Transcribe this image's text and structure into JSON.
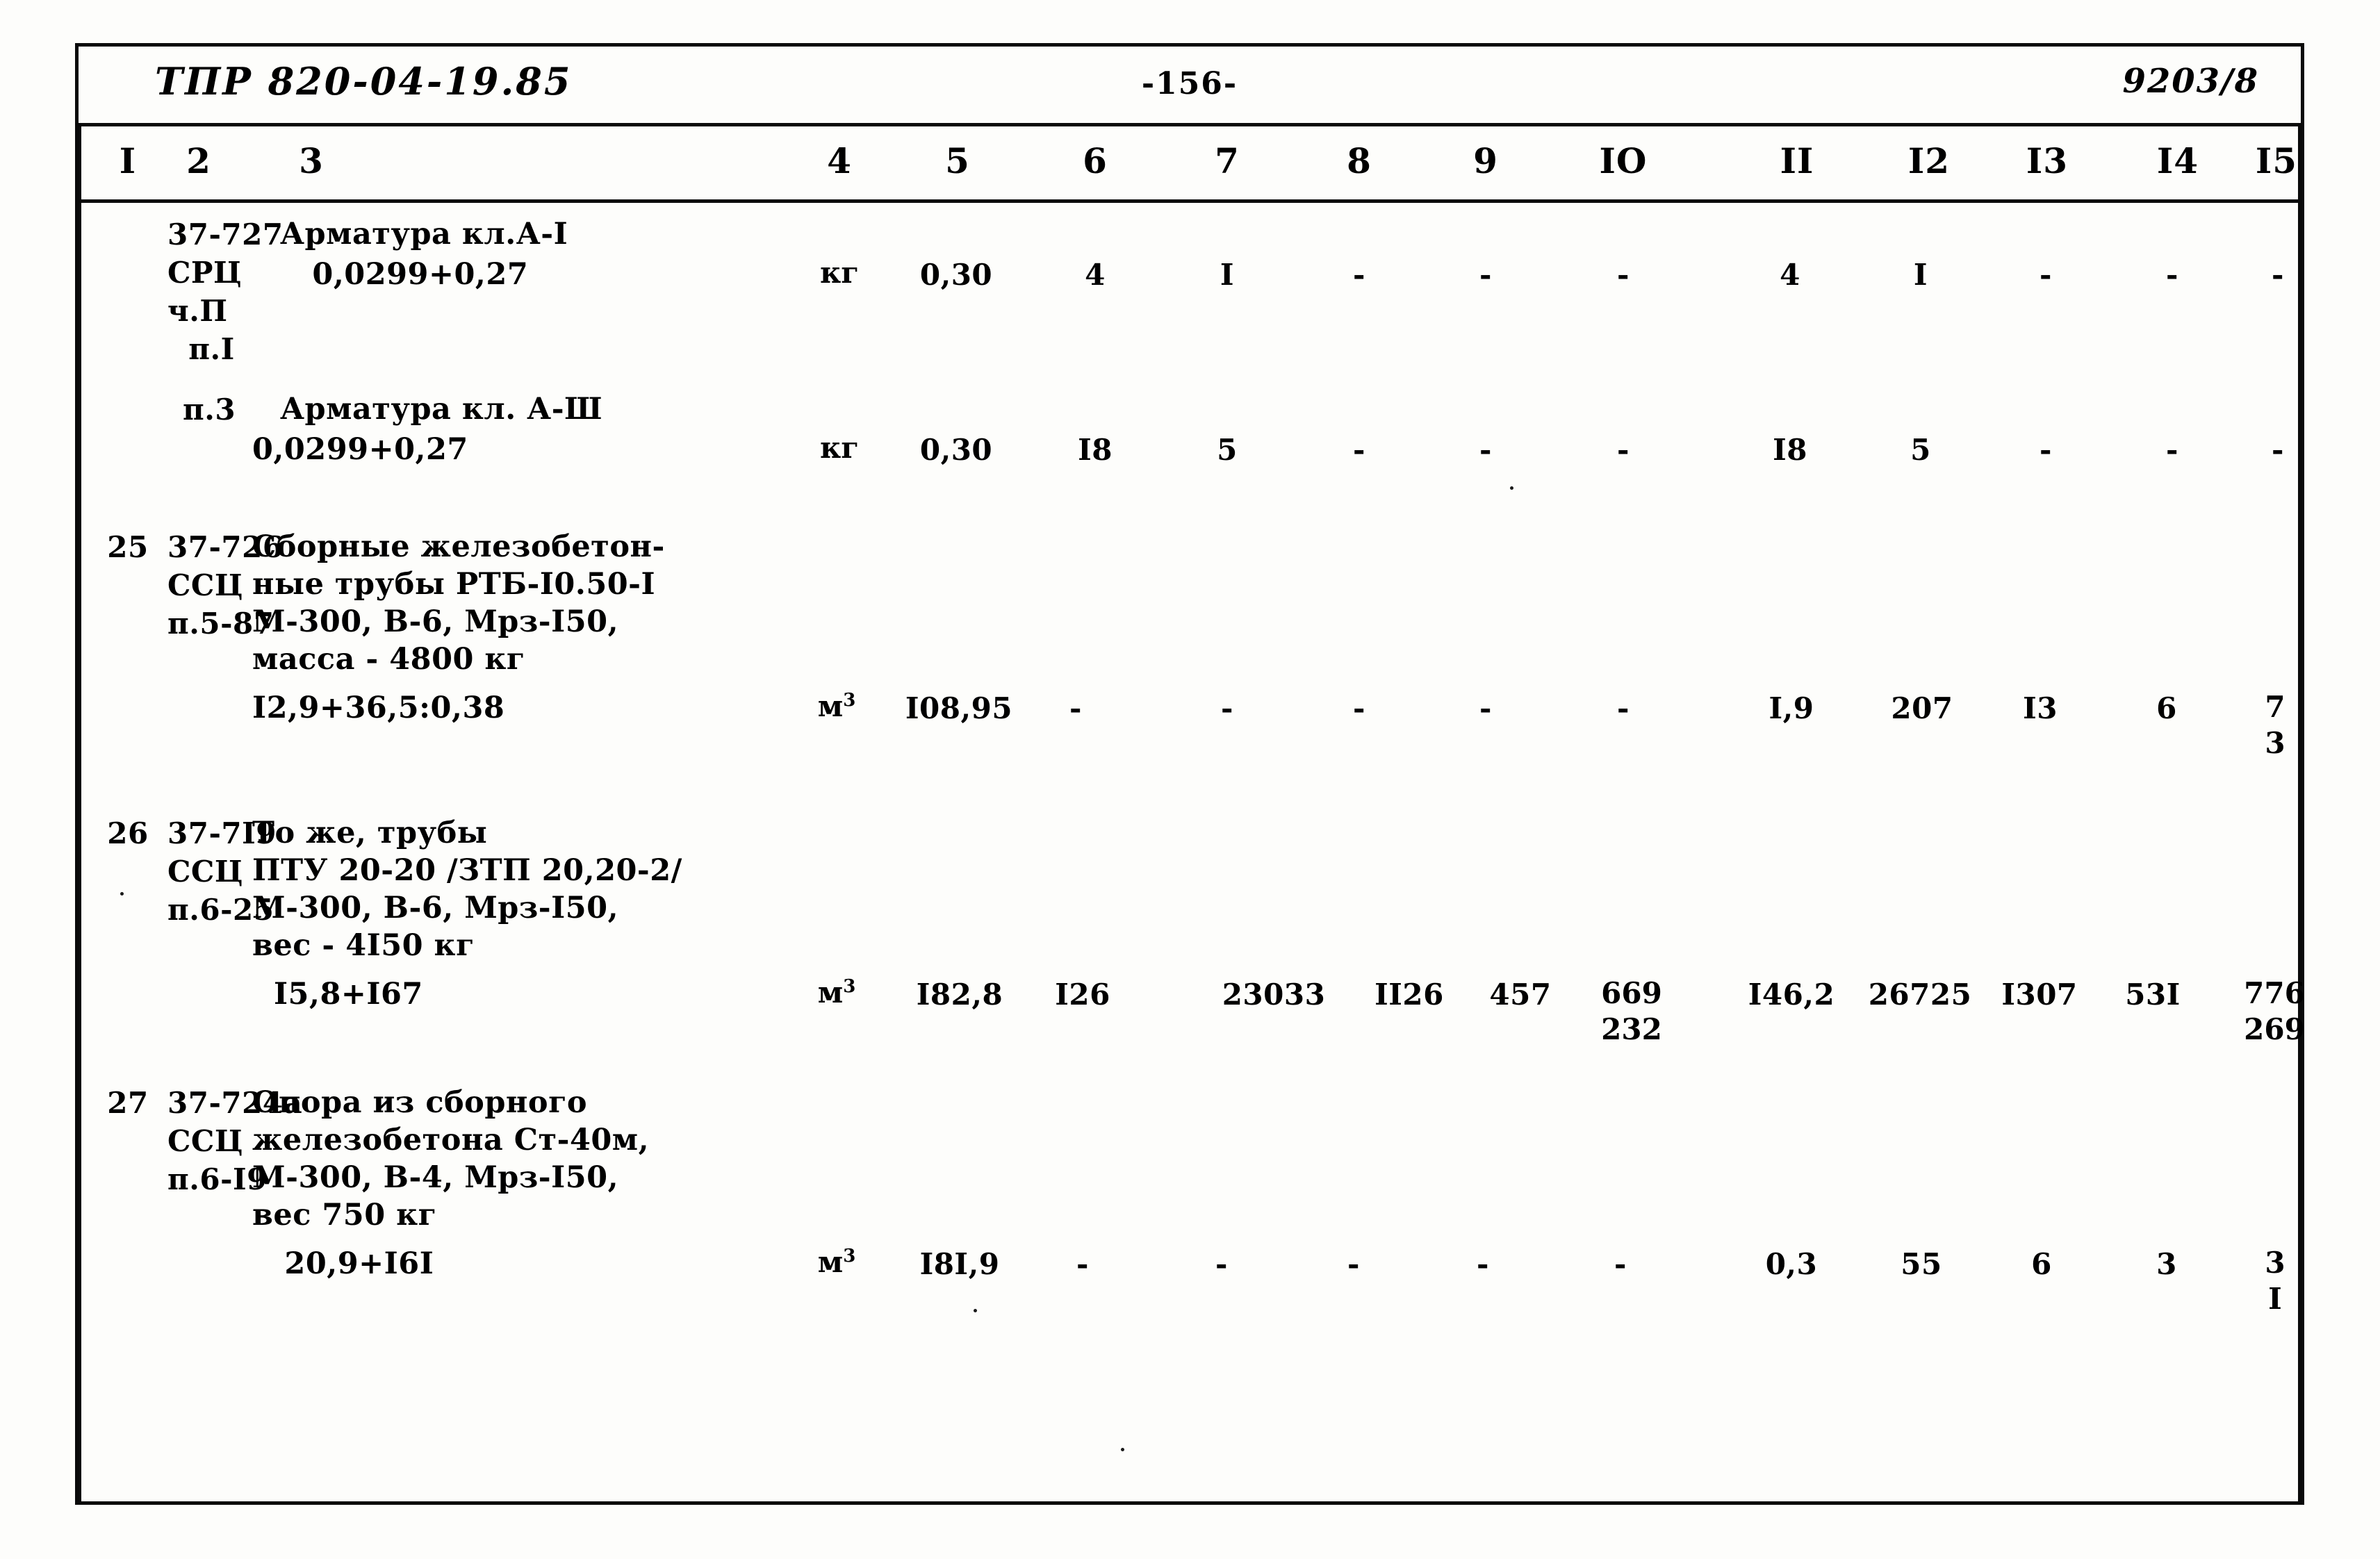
{
  "document": {
    "header": {
      "left_code": "ТПР 820-04-19.85",
      "page_number": "-156-",
      "right_code": "9203/8"
    },
    "column_numbers": [
      "I",
      "2",
      "3",
      "4",
      "5",
      "6",
      "7",
      "8",
      "9",
      "IO",
      "II",
      "I2",
      "I3",
      "I4",
      "I5"
    ]
  },
  "rows": [
    {
      "num": "",
      "code": "37-727\nСРЦ\nч.П\n  п.I",
      "desc_title": "Арматура кл.А-I",
      "desc_formula": "   0,0299+0,27",
      "unit": "кг",
      "unit_sup": "",
      "c5": "0,30",
      "c6": "4",
      "c7": "I",
      "c8": "-",
      "c9": "-",
      "c10": "-",
      "c11": "4",
      "c12": "I",
      "c13": "-",
      "c14": "-",
      "c15": "-"
    },
    {
      "num": "",
      "code": "п.3",
      "desc_title": "Арматура кл. А-Ш",
      "desc_formula": "0,0299+0,27",
      "unit": "кг",
      "unit_sup": "",
      "c5": "0,30",
      "c6": "I8",
      "c7": "5",
      "c8": "-",
      "c9": "-",
      "c10": "-",
      "c11": "I8",
      "c12": "5",
      "c13": "-",
      "c14": "-",
      "c15": "-"
    },
    {
      "num": "25",
      "code": "37-726\nССЦ\nп.5-87",
      "desc_title": "Сборные железобетон-\nные трубы РТБ-I0.50-I\nМ-300, В-6, Мрз-I50,\nмасса - 4800 кг",
      "desc_formula": "I2,9+36,5:0,38",
      "unit": "м",
      "unit_sup": "3",
      "c5": "I08,95",
      "c6": "-",
      "c7": "-",
      "c8": "-",
      "c9": "-",
      "c10": "-",
      "c11": "I,9",
      "c12": "207",
      "c13": "I3",
      "c14": "6",
      "c15": "7\n3"
    },
    {
      "num": "26",
      "code": "37-7I9\nССЦ\nп.6-25",
      "desc_title": "То же, трубы\nПТУ 20-20 /ЗТП 20,20-2/\nМ-300, В-6, Мрз-I50,\nвес - 4I50 кг",
      "desc_formula": "  I5,8+I67",
      "unit": "м",
      "unit_sup": "3",
      "c5": "I82,8",
      "c6": "I26",
      "c7": "",
      "c8": "23033",
      "c9": "II26",
      "c9b": "457",
      "c10": "669\n232",
      "c11": "I46,2",
      "c12": "26725",
      "c13": "I307",
      "c14": "53I",
      "c15": "776\n269"
    },
    {
      "num": "27",
      "code": "37-724а\nССЦ\nп.6-I9",
      "desc_title": "Опора из сборного\nжелезобетона Ст-40м,\nМ-300, В-4, Мрз-I50,\nвес 750 кг",
      "desc_formula": "   20,9+I6I",
      "unit": "м",
      "unit_sup": "3",
      "c5": "I8I,9",
      "c6": "-",
      "c7": "-",
      "c8": "-",
      "c9": "-",
      "c10": "-",
      "c11": "0,3",
      "c12": "55",
      "c13": "6",
      "c14": "3",
      "c15": "3\nI"
    }
  ]
}
